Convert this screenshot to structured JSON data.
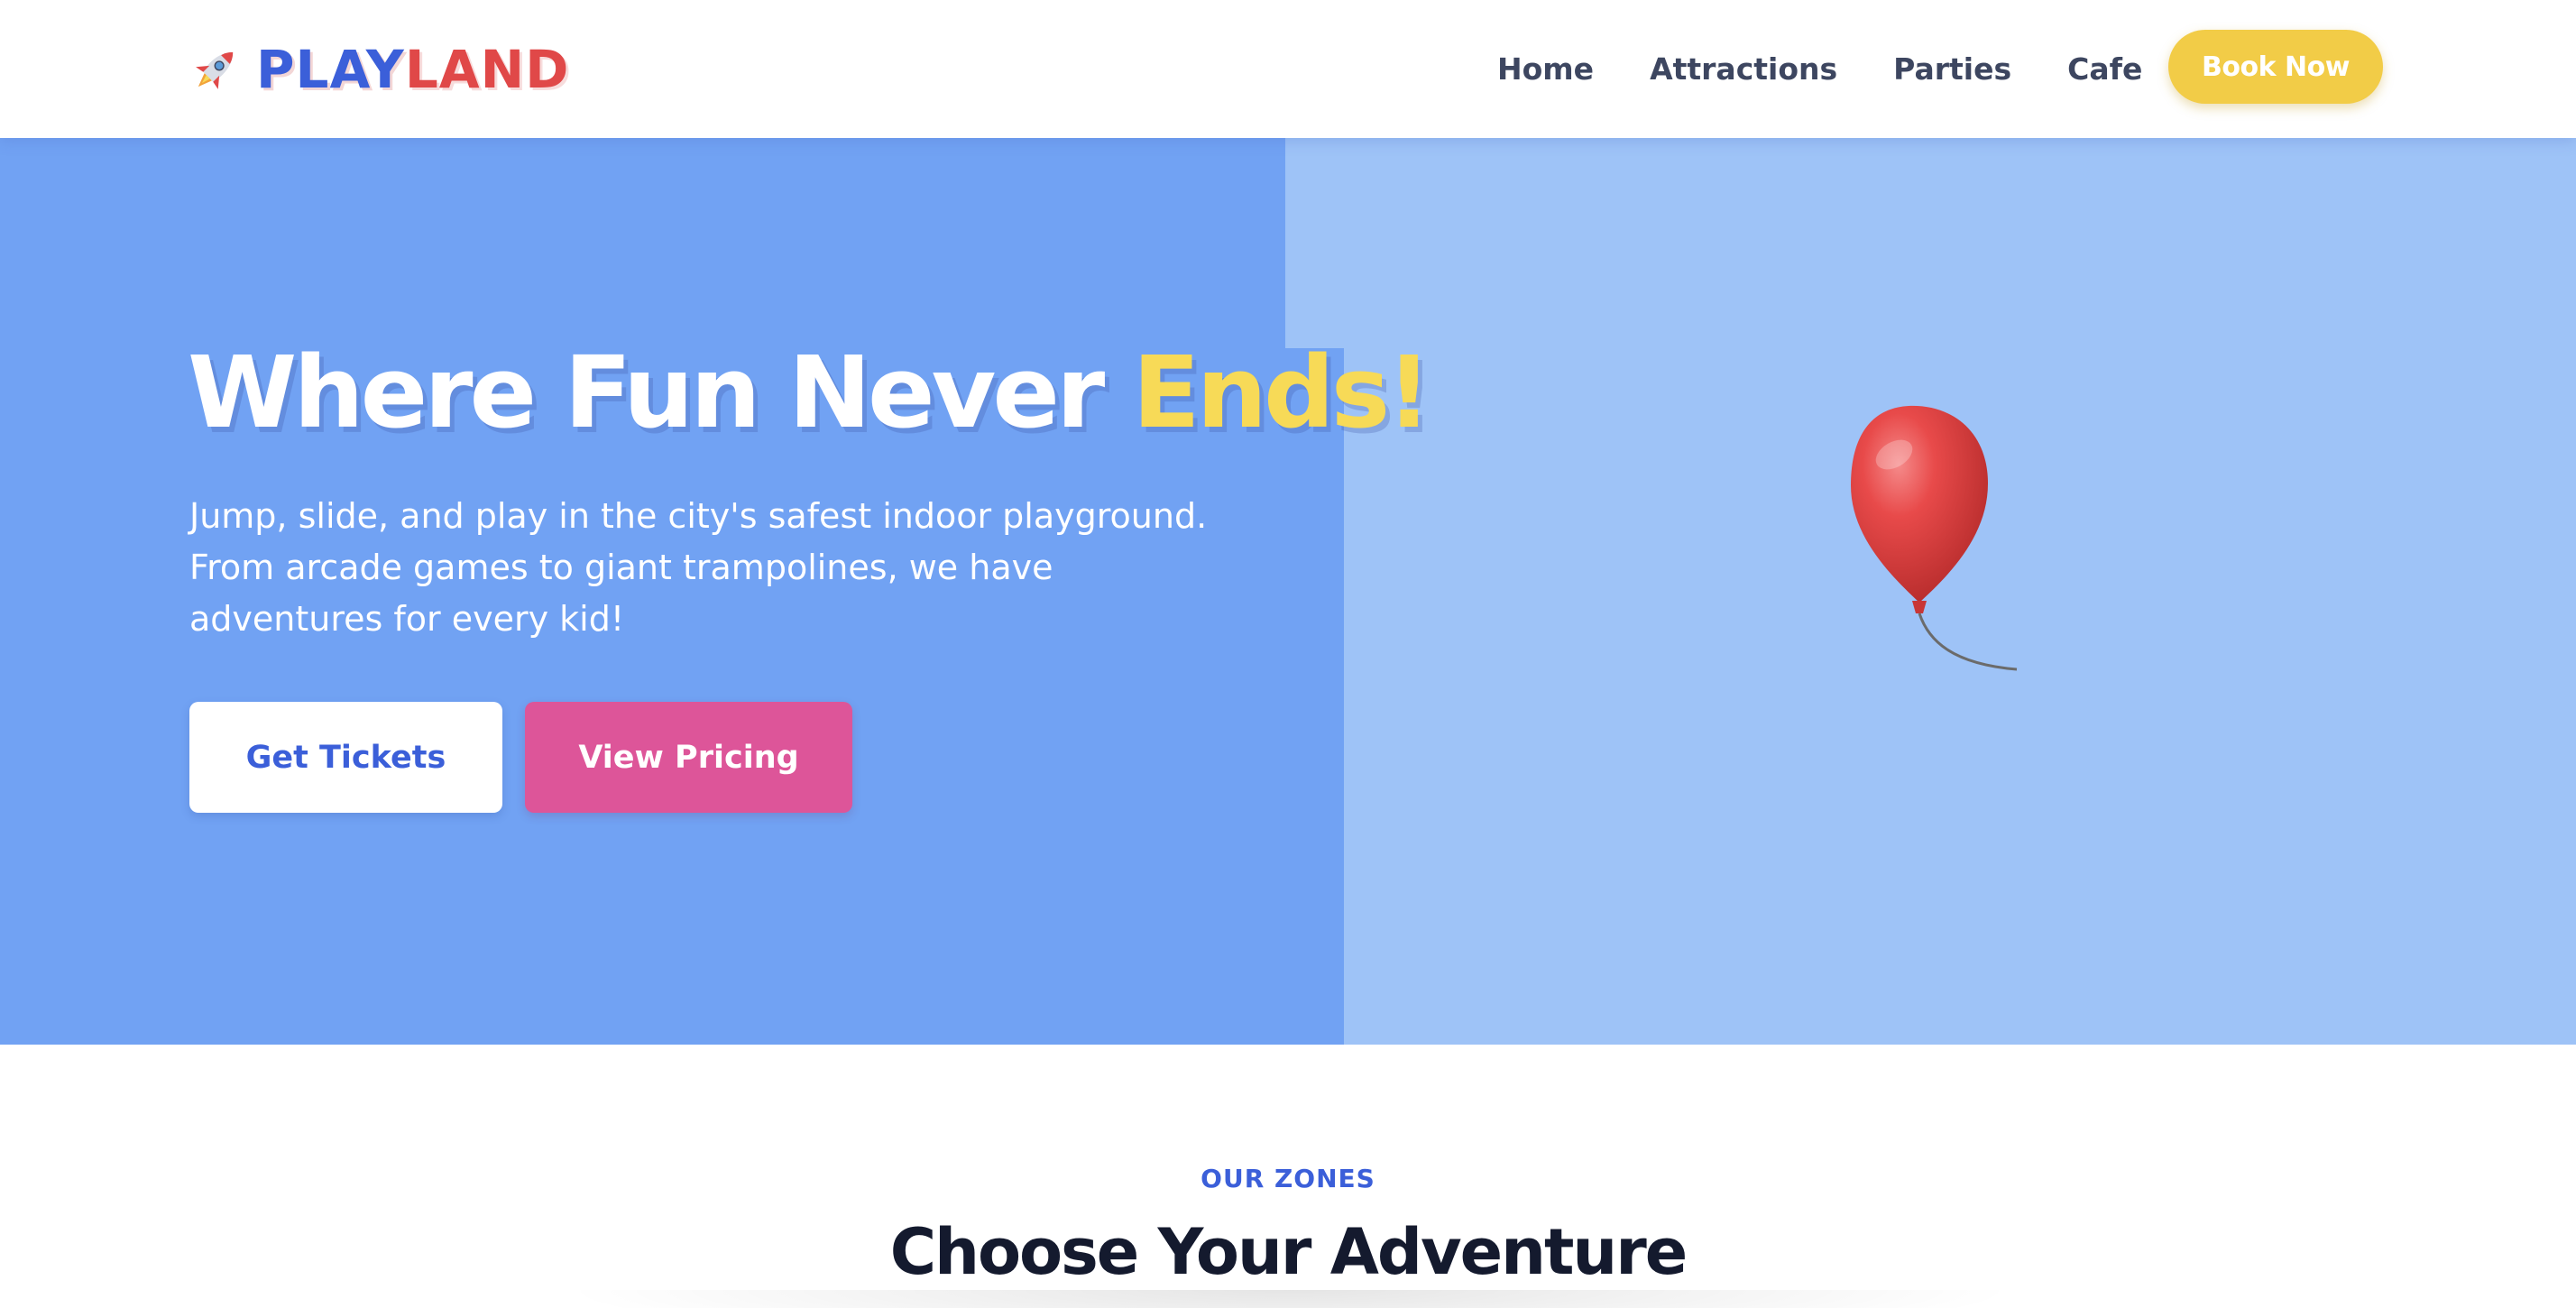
{
  "brand": {
    "icon": "rocket-icon",
    "name_part1": "PLAY",
    "name_part2": "LAND",
    "colors": {
      "primary": "#3b5fd9",
      "secondary": "#e04848"
    }
  },
  "nav": {
    "links": [
      "Home",
      "Attractions",
      "Parties",
      "Cafe"
    ],
    "cta": "Book Now",
    "cta_color": "#f2cc47"
  },
  "hero": {
    "title_main": "Where Fun Never ",
    "title_accent": "Ends!",
    "description": "Jump, slide, and play in the city's safest indoor playground. From arcade games to giant trampolines, we have adventures for every kid!",
    "primary_button": "Get Tickets",
    "secondary_button": "View Pricing",
    "image_icon": "balloon-icon",
    "colors": {
      "left_bg": "#71a2f3",
      "right_bg": "#9ec3f7",
      "accent": "#f7da57",
      "secondary_button": "#dd5599"
    }
  },
  "zones": {
    "eyebrow": "OUR ZONES",
    "title": "Choose Your Adventure"
  }
}
